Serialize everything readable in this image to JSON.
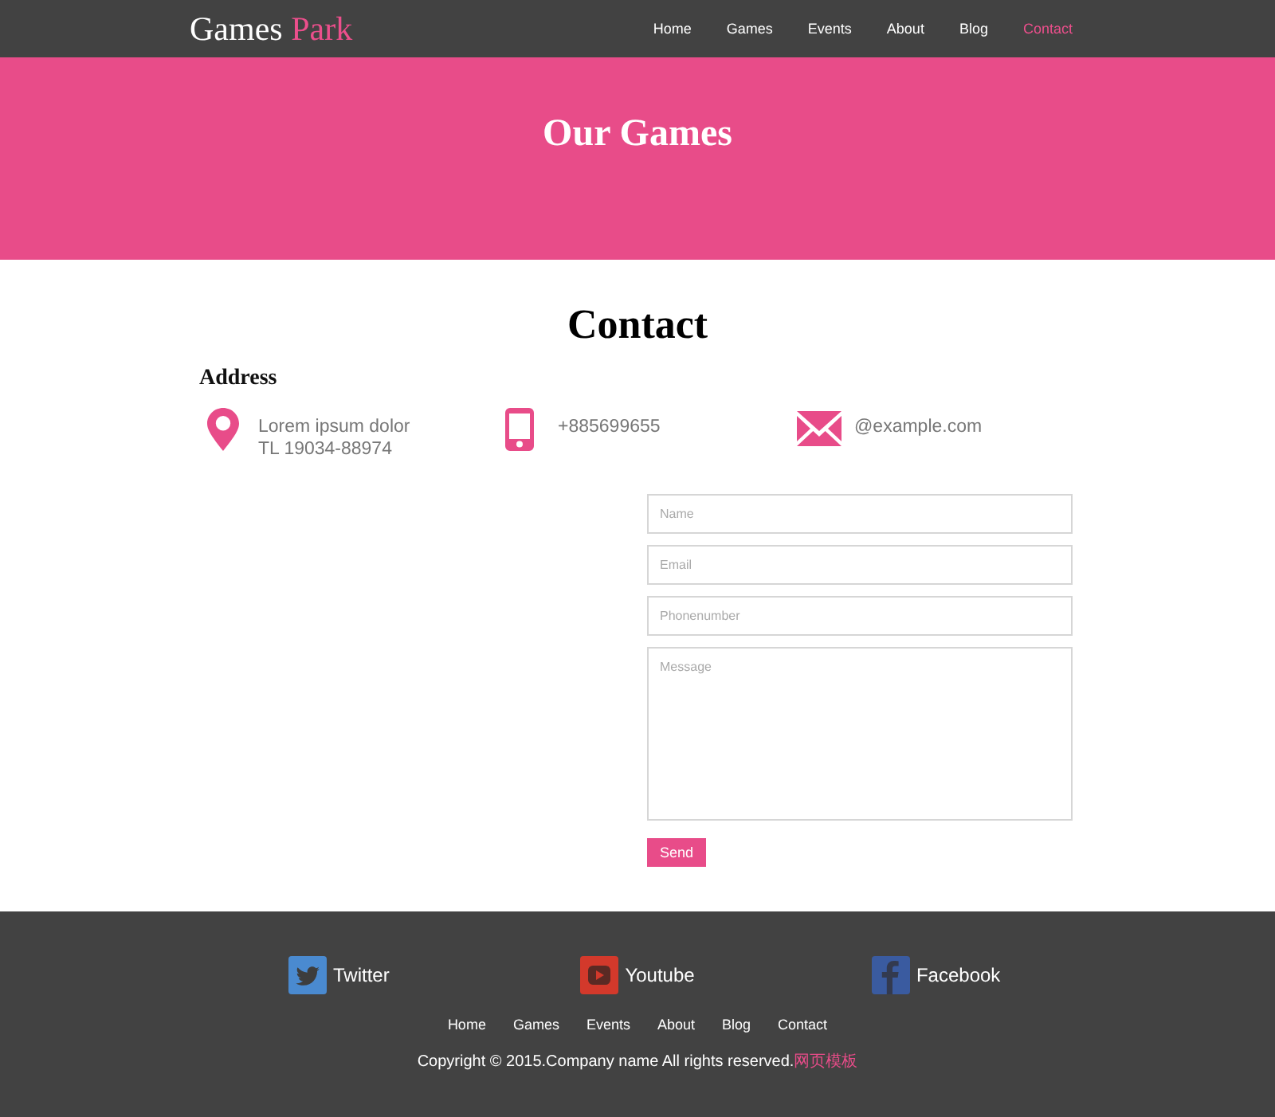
{
  "header": {
    "logo": {
      "name": "Games",
      "accent": "Park"
    },
    "nav": [
      {
        "label": "Home",
        "selected": false
      },
      {
        "label": "Games",
        "selected": false
      },
      {
        "label": "Events",
        "selected": false
      },
      {
        "label": "About",
        "selected": false
      },
      {
        "label": "Blog",
        "selected": false
      },
      {
        "label": "Contact",
        "selected": true
      }
    ]
  },
  "hero": {
    "title": "Our Games"
  },
  "contact": {
    "title": "Contact",
    "address_heading": "Address",
    "items": [
      {
        "kind": "location",
        "lines": [
          "Lorem ipsum dolor",
          "TL 19034-88974"
        ]
      },
      {
        "kind": "phone",
        "lines": [
          "+885699655"
        ]
      },
      {
        "kind": "email",
        "lines": [
          "@example.com"
        ]
      }
    ]
  },
  "form": {
    "fields": [
      {
        "kind": "input",
        "placeholder": "Name"
      },
      {
        "kind": "input",
        "placeholder": "Email"
      },
      {
        "kind": "input",
        "placeholder": "Phonenumber"
      },
      {
        "kind": "textarea",
        "placeholder": "Message"
      }
    ],
    "submit": "Send"
  },
  "footer": {
    "social": [
      {
        "kind": "twitter",
        "label": "Twitter"
      },
      {
        "kind": "youtube",
        "label": "Youtube"
      },
      {
        "kind": "facebook",
        "label": "Facebook"
      }
    ],
    "nav": [
      "Home",
      "Games",
      "Events",
      "About",
      "Blog",
      "Contact"
    ],
    "copyright": "Copyright © 2015.Company name All rights reserved.",
    "copyright_link": "网页模板"
  }
}
